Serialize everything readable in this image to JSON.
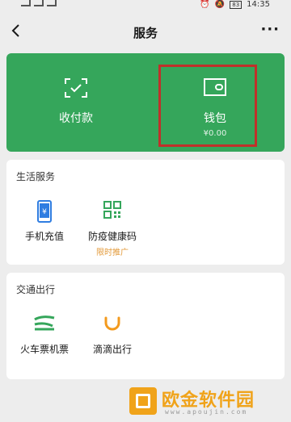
{
  "status_bar": {
    "time": "14:35",
    "battery": "83"
  },
  "nav": {
    "title": "服务",
    "more": "···"
  },
  "wallet_card": {
    "pay_label": "收付款",
    "wallet_label": "钱包",
    "wallet_balance": "¥0.00",
    "accent": "#35a65b",
    "highlight_color": "#c0302a"
  },
  "life_services": {
    "title": "生活服务",
    "items": [
      {
        "label": "手机充值",
        "icon": "mobile-topup-icon"
      },
      {
        "label": "防疫健康码",
        "icon": "qr-code-icon",
        "badge": "限时推广"
      }
    ]
  },
  "travel_services": {
    "title": "交通出行",
    "items": [
      {
        "label": "火车票机票",
        "icon": "train-icon"
      },
      {
        "label": "滴滴出行",
        "icon": "didi-icon"
      }
    ]
  },
  "watermark": {
    "brand": "欧金软件园",
    "url": "www.apoujin.com"
  }
}
